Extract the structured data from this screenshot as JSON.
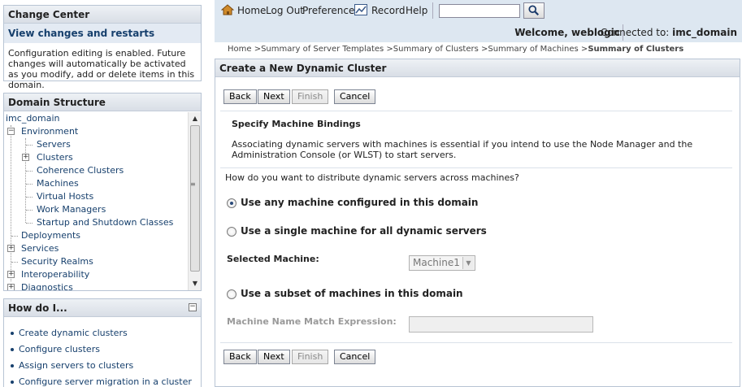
{
  "change_center": {
    "title": "Change Center",
    "link": "View changes and restarts",
    "description": "Configuration editing is enabled. Future changes will automatically be activated as you modify, add or delete items in this domain."
  },
  "domain_structure": {
    "title": "Domain Structure",
    "items": [
      {
        "label": "imc_domain"
      },
      {
        "label": "Environment",
        "expander": "⊟"
      },
      {
        "label": "Servers"
      },
      {
        "label": "Clusters",
        "expander": "⊞"
      },
      {
        "label": "Coherence Clusters"
      },
      {
        "label": "Machines"
      },
      {
        "label": "Virtual Hosts"
      },
      {
        "label": "Work Managers"
      },
      {
        "label": "Startup and Shutdown Classes"
      },
      {
        "label": "Deployments"
      },
      {
        "label": "Services",
        "expander": "⊞"
      },
      {
        "label": "Security Realms"
      },
      {
        "label": "Interoperability",
        "expander": "⊞"
      },
      {
        "label": "Diagnostics",
        "expander": "⊞"
      }
    ]
  },
  "how_do_i": {
    "title": "How do I...",
    "collapse": "−",
    "items": [
      "Create dynamic clusters",
      "Configure clusters",
      "Assign servers to clusters",
      "Configure server migration in a cluster"
    ]
  },
  "topnav": {
    "home": "Home",
    "logout": "Log Out",
    "preferences": "Preferences",
    "record": "Record",
    "help": "Help",
    "search_value": ""
  },
  "header": {
    "welcome": "Welcome, weblogic",
    "connected_prefix": "Connected to:",
    "connected_domain": "imc_domain"
  },
  "breadcrumb": {
    "trail": "Home >Summary of Server Templates >Summary of Clusters >Summary of Machines >",
    "current": "Summary of Clusters"
  },
  "main": {
    "title": "Create a New Dynamic Cluster",
    "buttons": {
      "back": "Back",
      "next": "Next",
      "finish": "Finish",
      "cancel": "Cancel"
    },
    "section_title": "Specify Machine Bindings",
    "section_desc": "Associating dynamic servers with machines is essential if you intend to use the Node Manager and the Administration Console (or WLST) to start servers.",
    "question": "How do you want to distribute dynamic servers across machines?",
    "option_any": "Use any machine configured in this domain",
    "option_single": "Use a single machine for all dynamic servers",
    "selected_machine_label": "Selected Machine:",
    "selected_machine_value": "Machine1",
    "option_subset": "Use a subset of machines in this domain",
    "match_expr_label": "Machine Name Match Expression:",
    "selected_option": "any"
  },
  "colors": {
    "link": "#17406d",
    "topbar_bg": "#dde7f1",
    "panel_border": "#b8c4d4"
  }
}
